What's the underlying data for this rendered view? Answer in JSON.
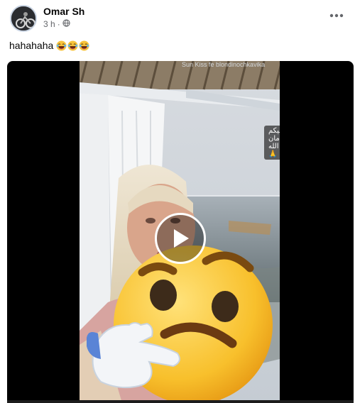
{
  "post": {
    "author": "Omar Sh",
    "time": "3 h",
    "dot": "·",
    "caption": "hahahaha",
    "caption_emoji": [
      "laughing-face",
      "laughing-face",
      "laughing-face"
    ]
  },
  "video": {
    "overlay_username": "Sun Kiss fe blondinochkavika",
    "overlay_text": "عليكم امان الله 🙏",
    "sticker": "thinking-face-emoji"
  },
  "colors": {
    "text_primary": "#050505",
    "text_secondary": "#65676b",
    "video_bg": "#000000"
  },
  "icons": {
    "privacy": "globe-icon",
    "menu": "more-horizontal-icon",
    "play": "play-icon"
  }
}
